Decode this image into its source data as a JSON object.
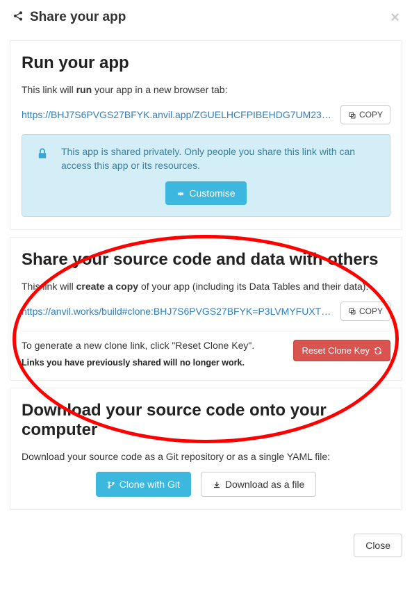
{
  "header": {
    "title": "Share your app",
    "close_x": "×"
  },
  "run": {
    "heading": "Run your app",
    "desc_pre": "This link will ",
    "desc_bold": "run",
    "desc_post": " your app in a new browser tab:",
    "link": "https://BHJ7S6PVGS27BFYK.anvil.app/ZGUELHCFPIBEHDG7UM23Y…",
    "copy_label": "COPY",
    "info_text": "This app is shared privately. Only people you share this link with can access this app or its resources.",
    "customise_label": "Customise"
  },
  "share": {
    "heading": "Share your source code and data with others",
    "desc_pre": "This link will ",
    "desc_bold": "create a copy",
    "desc_post": " of your app (including its Data Tables and their data):",
    "link": "https://anvil.works/build#clone:BHJ7S6PVGS27BFYK=P3LVMYFUXTR…",
    "copy_label": "COPY",
    "reset_text": "To generate a new clone link, click \"Reset Clone Key\".",
    "reset_warn": "Links you have previously shared will no longer work.",
    "reset_btn": "Reset Clone Key"
  },
  "download": {
    "heading": "Download your source code onto your computer",
    "desc": "Download your source code as a Git repository or as a single YAML file:",
    "git_label": "Clone with Git",
    "file_label": "Download as a file"
  },
  "footer": {
    "close_label": "Close"
  }
}
